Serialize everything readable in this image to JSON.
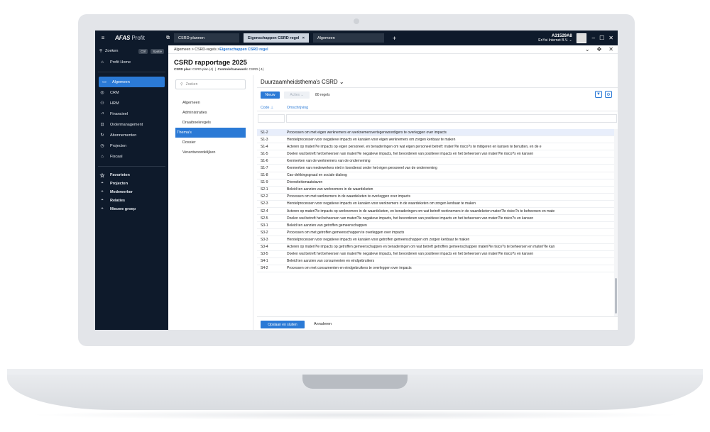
{
  "app": {
    "logo": "AFAS",
    "logo_suffix": "Profit"
  },
  "topbar": {
    "tabs": [
      {
        "label": "CSRD-plannen"
      },
      {
        "label": "Eigenschappen CSRD regel",
        "close": "×"
      },
      {
        "label": "Algemeen"
      }
    ],
    "plus": "+",
    "user_id": "A31529A8",
    "user_company": "EnYsi Internet B.V.",
    "min": "–",
    "max": "☐",
    "close": "✕"
  },
  "sidebar": {
    "search_label": "Zoeken",
    "kbd_ctrl": "Ctrl",
    "kbd_space": "Spatie",
    "home": "Profit Home",
    "items": [
      {
        "label": "Algemeen",
        "icon": "window-icon",
        "glyph": "▭"
      },
      {
        "label": "CRM",
        "icon": "crm-icon",
        "glyph": "◎"
      },
      {
        "label": "HRM",
        "icon": "people-icon",
        "glyph": "⚇"
      },
      {
        "label": "Financieel",
        "icon": "chart-icon",
        "glyph": "⩘"
      },
      {
        "label": "Ordermanagement",
        "icon": "order-icon",
        "glyph": "⊡"
      },
      {
        "label": "Abonnementen",
        "icon": "refresh-icon",
        "glyph": "↻"
      },
      {
        "label": "Projecten",
        "icon": "clock-icon",
        "glyph": "◷"
      },
      {
        "label": "Fiscaal",
        "icon": "fiscal-icon",
        "glyph": "⌂"
      }
    ],
    "favorites_label": "Favorieten",
    "favorites": [
      {
        "label": "Projecten"
      },
      {
        "label": "Medewerker"
      },
      {
        "label": "Relaties"
      },
      {
        "label": "Nieuwe groep"
      }
    ]
  },
  "breadcrumb": {
    "path": "Algemeen > CSRD-regels > ",
    "current": "Eigenschappen CSRD regel"
  },
  "page": {
    "title": "CSRD rapportage 2025",
    "plan_label": "CSRD plan:",
    "plan_value": "CSRD plan (4)",
    "framework_label": "Controleframework:",
    "framework_value": "CSRD (-1)"
  },
  "leftnav": {
    "search_placeholder": "Zoeken",
    "items": [
      {
        "label": "Algemeen"
      },
      {
        "label": "Administraties"
      },
      {
        "label": "Draaiboekregels"
      },
      {
        "label": "Thema's"
      },
      {
        "label": "Dossier"
      },
      {
        "label": "Verantwoordelijken"
      }
    ]
  },
  "main": {
    "section_title": "Duurzaamheidsthema's CSRD ⌄",
    "new_button": "Nieuw",
    "actions_button": "Acties ⌄",
    "count": "80 regels",
    "col_code": "Code ⊥",
    "col_desc": "Omschrijving",
    "rows": [
      {
        "code": "S1-2",
        "desc": "Processen om met eigen werknemers en werknemersvertegenwoordigers te overleggen over impacts"
      },
      {
        "code": "S1-3",
        "desc": "Herstelprocessen voor negatieve impacts en kanalen voor eigen werknemers om zorgen kenbaar te maken"
      },
      {
        "code": "S1-4",
        "desc": "Acteren op materi?le impacts op eigen personeel. en benaderingen om wat eigen personeel betreft: materi?le risico?s te mitigeren en kansen te benutten, en de e"
      },
      {
        "code": "S1-5",
        "desc": "Doelen wat betreft het beheersen van materi?le negatieve impacts, het bevorderen van positieve impacts en het beheersen van materi?le risico?s en kansen"
      },
      {
        "code": "S1-6",
        "desc": "Kenmerken van de werknemers van de onderneming"
      },
      {
        "code": "S1-7",
        "desc": "Kenmerken van medewerkers niet in loondienst onder het eigen personeel van de onderneming"
      },
      {
        "code": "S1-8",
        "desc": "Cao-dekkingsgraad en sociale dialoog"
      },
      {
        "code": "S1-9",
        "desc": "Diversiteitsmaatstaven"
      },
      {
        "code": "S2-1",
        "desc": "Beleid ten aanzien van werknemers in de waardeketen"
      },
      {
        "code": "S2-2",
        "desc": "Processen om met werknemers in de waardeketen te overleggen over impacts"
      },
      {
        "code": "S2-3",
        "desc": "Herstelprocessen voor negatieve impacts en kanalen voor werknemers in de waardeketen om zorgen kenbaar te maken"
      },
      {
        "code": "S2-4",
        "desc": "Acteren op materi?le impacts op werknemers in de waardeketen, en benaderingen om wat betreft werknemers in de waardeketen materi?le risico?s te beheersen en mate"
      },
      {
        "code": "S2-5",
        "desc": "Doelen wat betreft het beheersen van materi?le negatieve impacts, het bevorderen van positieve impacts en het beheersen van materi?le risico?s en kansen"
      },
      {
        "code": "S3-1",
        "desc": "Beleid ten aanzien van getroffen gemeenschappen"
      },
      {
        "code": "S3-2",
        "desc": "Processen om met getroffen gemeenschappen te overleggen over impacts"
      },
      {
        "code": "S3-3",
        "desc": "Herstelprocessen voor negatieve impacts en kanalen voor getroffen gemeenschappen om zorgen kenbaar te maken"
      },
      {
        "code": "S3-4",
        "desc": "Acteren op materi?le impacts op getroffen gemeenschappen en benaderingen om wat betreft getroffen gemeenschappen materi?le risico?s te beheersen en materi?le kan"
      },
      {
        "code": "S3-5",
        "desc": "Doelen wat betreft het beheersen van materi?le negatieve impacts, het bevorderen van positieve impacts en het beheersen van materi?le risico?s en kansen"
      },
      {
        "code": "S4-1",
        "desc": "Beleid ten aanzien van consumenten en eindgebruikers"
      },
      {
        "code": "S4-2",
        "desc": "Processen om met consumenten en eindgebruikers te overleggen over impacts"
      }
    ]
  },
  "footer": {
    "save": "Opslaan en sluiten",
    "cancel": "Annuleren"
  },
  "colors": {
    "accent": "#2b7ad6",
    "nav_bg": "#0e1a2b"
  }
}
